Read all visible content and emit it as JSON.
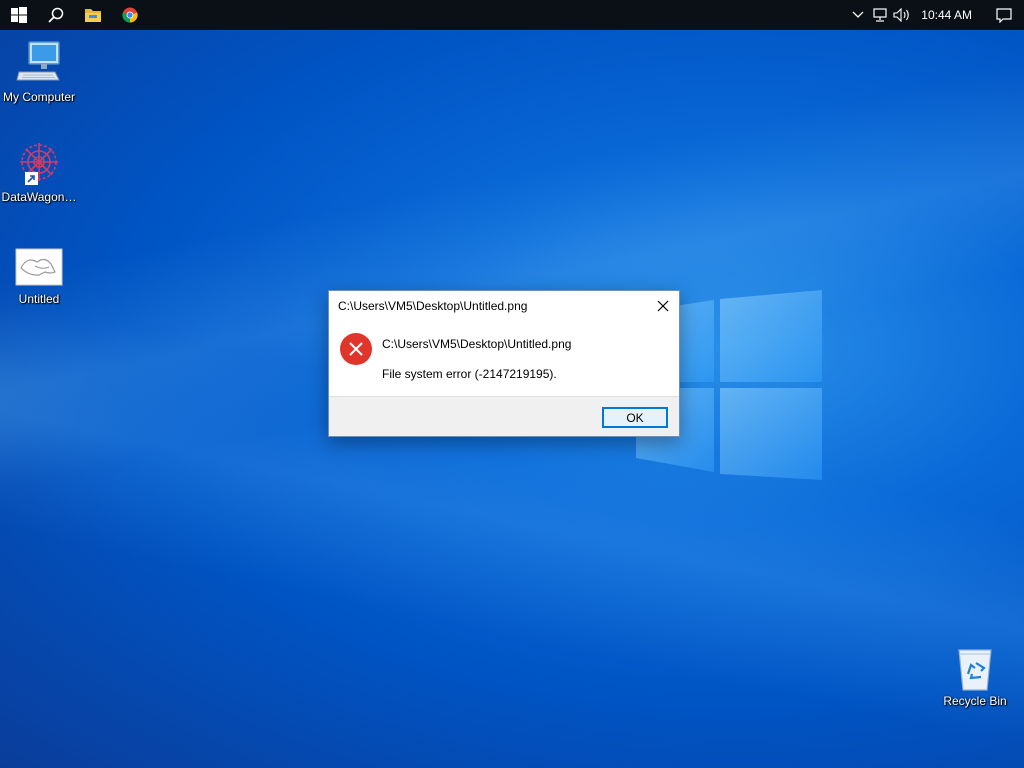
{
  "taskbar": {
    "start_icon": "windows-start-icon",
    "search_icon": "search-icon",
    "explorer_icon": "file-explorer-icon",
    "chrome_icon": "chrome-icon",
    "tray": {
      "chevron_icon": "chevron-up-icon",
      "network_icon": "network-icon",
      "volume_icon": "volume-icon",
      "clock": "10:44 AM",
      "notification_icon": "action-center-icon"
    }
  },
  "desktop": {
    "icons": [
      {
        "label": "My Computer",
        "icon": "computer-icon"
      },
      {
        "label": "DataWagon…",
        "icon": "datawagon-shortcut-icon"
      },
      {
        "label": "Untitled",
        "icon": "image-file-icon"
      },
      {
        "label": "Recycle Bin",
        "icon": "recycle-bin-icon"
      }
    ]
  },
  "dialog": {
    "title": "C:\\Users\\VM5\\Desktop\\Untitled.png",
    "path": "C:\\Users\\VM5\\Desktop\\Untitled.png",
    "message": "File system error (-2147219195).",
    "ok_label": "OK",
    "icon": "error-icon"
  },
  "colors": {
    "taskbar": "#0b0f16",
    "desktop_blue": "#0a6ad8",
    "error_red": "#e0352b",
    "button_border": "#0078d7"
  }
}
